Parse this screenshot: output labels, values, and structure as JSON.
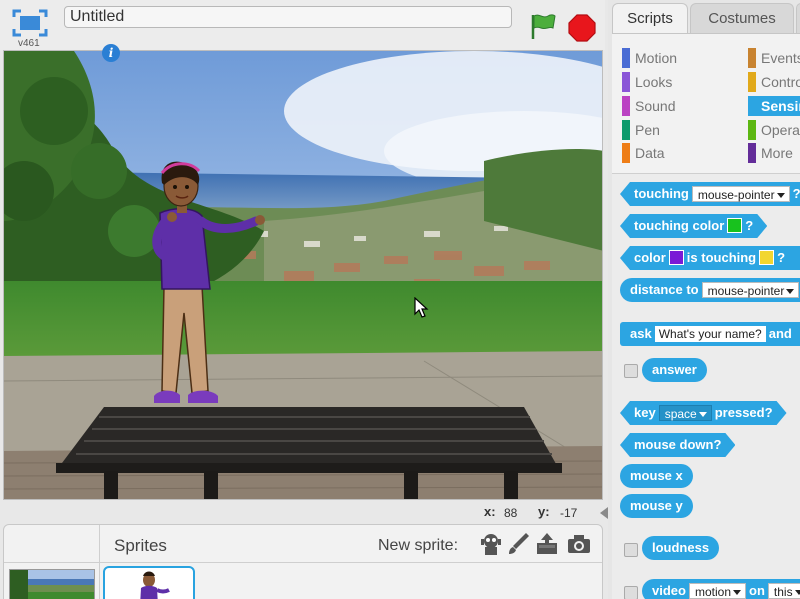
{
  "header": {
    "version": "v461",
    "title_value": "Untitled"
  },
  "stage": {
    "mouse": {
      "x_label": "x:",
      "x_value": "88",
      "y_label": "y:",
      "y_value": "-17"
    }
  },
  "sprite_pane": {
    "sprites_label": "Sprites",
    "new_sprite_label": "New sprite:",
    "info_badge": "i"
  },
  "palette": {
    "tabs": [
      "Scripts",
      "Costumes"
    ],
    "categories": [
      {
        "label": "Motion",
        "color": "#4a6cd4"
      },
      {
        "label": "Events",
        "color": "#c88330"
      },
      {
        "label": "Looks",
        "color": "#8a55d7"
      },
      {
        "label": "Control",
        "color": "#e1a91a"
      },
      {
        "label": "Sound",
        "color": "#bb42c3"
      },
      {
        "label": "Sensing",
        "color": "#2ca5e2"
      },
      {
        "label": "Pen",
        "color": "#0e9a6c"
      },
      {
        "label": "Operators",
        "color": "#5cb712"
      },
      {
        "label": "Data",
        "color": "#ee7d16"
      },
      {
        "label": "More",
        "color": "#632d99"
      }
    ],
    "blocks": {
      "touching": {
        "label": "touching",
        "menu": "mouse-pointer",
        "end": "?"
      },
      "touching_color": {
        "label": "touching color",
        "end": "?",
        "swatch": "#18c21e"
      },
      "color_touching": {
        "label": "color",
        "mid": "is touching",
        "end": "?",
        "swatch1": "#7a1bd6",
        "swatch2": "#f2d630"
      },
      "distance": {
        "label": "distance to",
        "menu": "mouse-pointer"
      },
      "ask": {
        "label": "ask",
        "input": "What's your name?",
        "end": "and"
      },
      "answer": {
        "label": "answer"
      },
      "key_pressed": {
        "label": "key",
        "menu": "space",
        "end": "pressed?"
      },
      "mouse_down": {
        "label": "mouse down?"
      },
      "mouse_x": {
        "label": "mouse x"
      },
      "mouse_y": {
        "label": "mouse y"
      },
      "loudness": {
        "label": "loudness"
      },
      "video": {
        "label": "video",
        "menu": "motion",
        "mid": "on",
        "menu2": "this"
      }
    }
  }
}
